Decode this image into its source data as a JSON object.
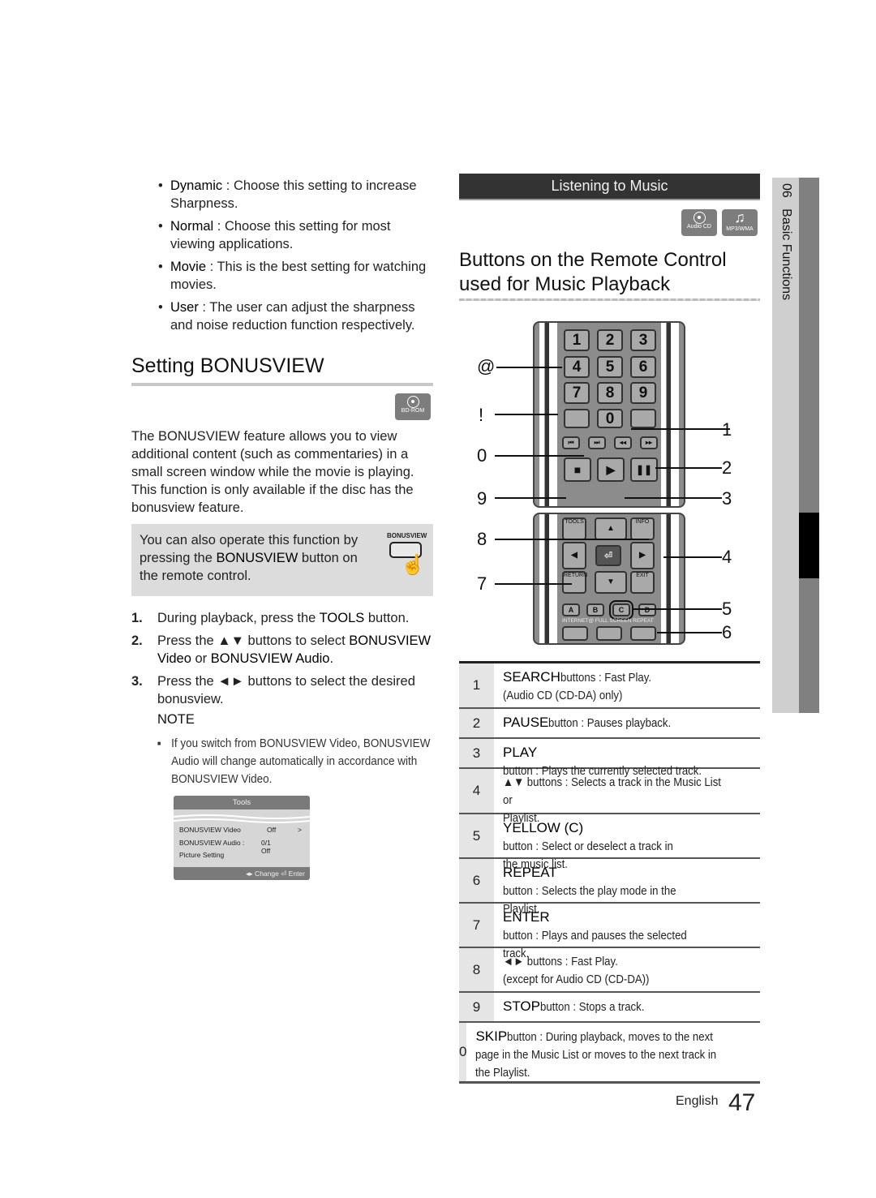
{
  "sharpness_options": [
    {
      "term": "Dynamic",
      "desc": " : Choose this setting to increase Sharpness."
    },
    {
      "term": "Normal",
      "desc": " : Choose this setting for most viewing applications."
    },
    {
      "term": "Movie",
      "desc": " : This is the best setting for watching movies."
    },
    {
      "term": "User",
      "desc": " : The user can adjust the sharpness and noise reduction function respectively."
    }
  ],
  "bonusview": {
    "title": "Setting BONUSVIEW",
    "badge": "BD-ROM",
    "intro": "The BONUSVIEW feature allows you to view additional content (such as commentaries) in a small screen window while the movie is playing. This function is only available if the disc has the bonusview feature.",
    "tip_pre": "You can also operate this function by pressing the ",
    "tip_bold": "BONUSVIEW",
    "tip_post": " button on the remote control.",
    "tip_button_label": "BONUSVIEW",
    "steps": [
      {
        "num": "1.",
        "pre": "During playback, press the ",
        "b1": "TOOLS",
        "mid": " button.",
        "b2": "",
        "post": ""
      },
      {
        "num": "2.",
        "pre": "Press the ▲▼ buttons to select ",
        "b1": "BONUSVIEW Video",
        "mid": " or ",
        "b2": "BONUSVIEW Audio",
        "post": "."
      },
      {
        "num": "3.",
        "pre": "Press the ◄► buttons to select the desired bonusview.",
        "b1": "",
        "mid": "",
        "b2": "",
        "post": ""
      }
    ],
    "note_title": "NOTE",
    "note_text": "If you switch from BONUSVIEW Video, BONUSVIEW Audio will change automatically in accordance with BONUSVIEW Video.",
    "tools_menu": {
      "title": "Tools",
      "rows": [
        {
          "label": "BONUSVIEW Video",
          "value": "Off",
          "arrow": ">"
        },
        {
          "label": "BONUSVIEW Audio :",
          "value": "0/1 Off",
          "arrow": ""
        },
        {
          "label": "Picture Setting",
          "value": "",
          "arrow": ""
        }
      ],
      "footer": "◂▸ Change   ⏎ Enter"
    }
  },
  "music": {
    "section_title": "Listening to Music",
    "badges": [
      "Audio CD",
      "MP3/WMA"
    ],
    "heading": "Buttons on the Remote Control used for Music Playback",
    "remote": {
      "number_keys": [
        "1",
        "2",
        "3",
        "4",
        "5",
        "6",
        "7",
        "8",
        "9",
        "0"
      ],
      "nav_labels": [
        "TOOLS",
        "INFO",
        "RETURN",
        "EXIT"
      ],
      "color_keys": [
        "A",
        "B",
        "C",
        "D"
      ],
      "color_captions": "INTERNET@ FULL SCREEN REPEAT",
      "callouts_left": [
        "@",
        "!",
        "0",
        "9",
        "8",
        "7"
      ],
      "callouts_right": [
        "1",
        "2",
        "3",
        "4",
        "5",
        "6"
      ]
    },
    "table": [
      {
        "num": "1",
        "key": "SEARCH",
        "text": " buttons : Fast Play.",
        "line2": "(Audio CD (CD-DA) only)"
      },
      {
        "num": "2",
        "key": "PAUSE",
        "text": " button : Pauses playback.",
        "line2": ""
      },
      {
        "num": "3",
        "key": "PLAY",
        "text": " button : Plays the currently selected track.",
        "line2": ""
      },
      {
        "num": "4",
        "key": "",
        "text": "▲▼ buttons : Selects a track in the Music List or",
        "line2": "Playlist."
      },
      {
        "num": "5",
        "key": "YELLOW (C)",
        "text": " button : Select or deselect a track in",
        "line2": "the music list."
      },
      {
        "num": "6",
        "key": "REPEAT",
        "text": " button : Selects the play mode in the",
        "line2": "Playlist."
      },
      {
        "num": "7",
        "key": "ENTER",
        "text": " button : Plays and pauses the selected",
        "line2": "track."
      },
      {
        "num": "8",
        "key": "",
        "text": "◄► buttons : Fast Play.",
        "line2": "(except for Audio CD (CD-DA))"
      },
      {
        "num": "9",
        "key": "STOP",
        "text": " button : Stops a track.",
        "line2": ""
      },
      {
        "num": "0",
        "key": "SKIP",
        "text": " button : During playback, moves to the next",
        "line2": "page in the Music List or moves to the next track in the Playlist."
      }
    ]
  },
  "footer": {
    "language": "English",
    "page": "47"
  },
  "side_tab": {
    "chapter": "06",
    "label": "Basic Functions"
  }
}
